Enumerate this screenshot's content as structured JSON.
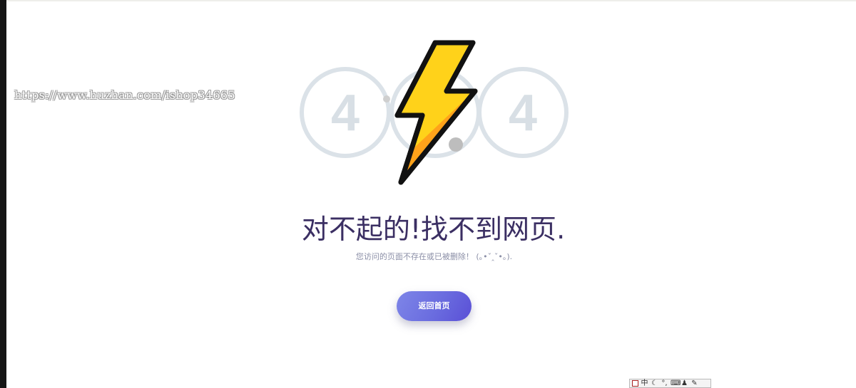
{
  "watermark": {
    "text": "https://www.huzhan.com/ishop34665"
  },
  "error": {
    "digit_left": "4",
    "digit_right": "4",
    "title": "对不起的!找不到网页.",
    "subtitle": "您访问的页面不存在或已被删除！ (｡•ˇ‸ˇ•｡)."
  },
  "actions": {
    "home_label": "返回首页"
  },
  "ime_toolbar": {
    "mode_label": "中",
    "moon_glyph": "☾",
    "punct_glyph": "°,",
    "keyboard_glyph": "⌨",
    "user_glyph": "♟",
    "tool_glyph": "✎"
  },
  "colors": {
    "title": "#3b2f63",
    "subtitle": "#8a8ea6",
    "button_start": "#7e86e8",
    "button_end": "#5a4fd6",
    "ring": "#dbe2e8",
    "bolt_yellow": "#ffd21a",
    "bolt_orange": "#ffa21a"
  }
}
